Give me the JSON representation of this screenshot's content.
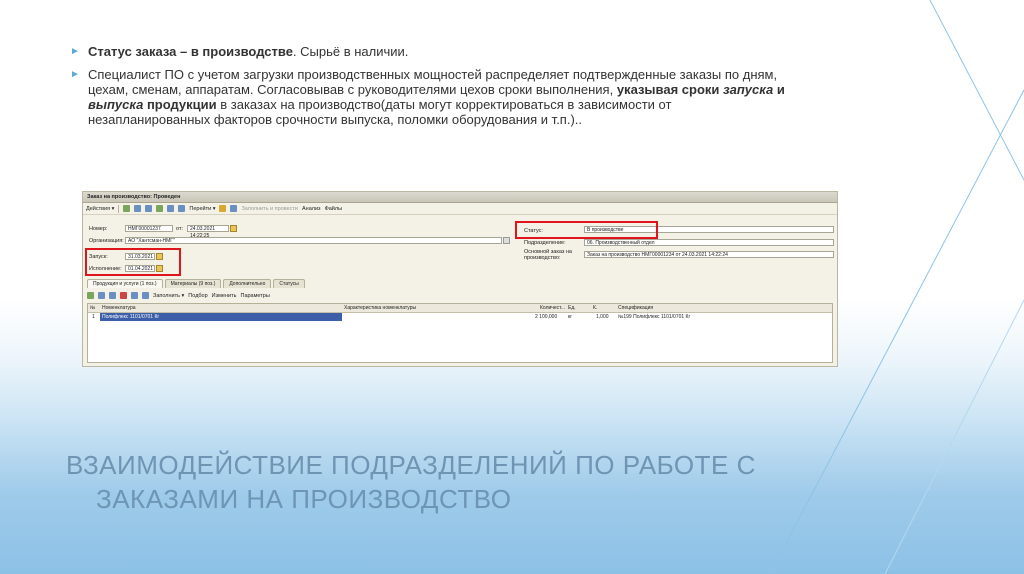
{
  "bullets": [
    {
      "bold": "Статус заказа – в производстве",
      "rest": ". Сырьё в наличии."
    },
    {
      "text_a": "Специалист ПО с учетом загрузки производственных мощностей распределяет подтвержденные заказы по дням, цехам, сменам, аппаратам. Согласовывав с руководителями цехов сроки выполнения,",
      "bold_a": " указывая сроки ",
      "bi_a": "запуска",
      "bold_b": " и ",
      "bi_b": "выпуска",
      "bold_c": " продукции",
      "text_b": " в заказах на производство(даты могут корректироваться в зависимости от незапланированных факторов срочности выпуска, поломки оборудования и т.п.).."
    }
  ],
  "title": {
    "line1": "ВЗАИМОДЕЙСТВИЕ ПОДРАЗДЕЛЕНИЙ ПО РАБОТЕ С",
    "line2": "ЗАКАЗАМИ НА ПРОИЗВОДСТВО"
  },
  "app": {
    "window_title": "Заказ на производство: Проведен",
    "toolbar": {
      "actions": "Действия ▾",
      "goto": "Перейти ▾",
      "fill_post": "Заполнить и провести",
      "analysis": "Анализ",
      "files": "Файлы"
    },
    "fields": {
      "number_label": "Номер:",
      "number_value": "НМГ00001237",
      "from_label": "от:",
      "date_value": "24.03.2021 14:22:25",
      "org_label": "Организация:",
      "org_value": "АО \"Хантсман-НМГ\"",
      "launch_label": "Запуск:",
      "launch_value": "31.03.2021",
      "exec_label": "Исполнение:",
      "exec_value": "01.04.2021",
      "status_label": "Статус:",
      "status_value": "В производстве",
      "dept_label": "Подразделение:",
      "dept_value": "06. Производственный отдел",
      "base_label": "Основной заказ на производство:",
      "base_value": "Заказ на производство НМГ00001234 от 24.03.2021 14:22:24"
    },
    "tabs": [
      "Продукция и услуги (1 поз.)",
      "Материалы (9 поз.)",
      "Дополнительно",
      "Статусы"
    ],
    "subtoolbar": {
      "fill": "Заполнить ▾",
      "select": "Подбор",
      "change": "Изменить",
      "params": "Параметры"
    },
    "table": {
      "headers": [
        "№",
        "Номенклатура",
        "Характеристика номенклатуры",
        "Количест...",
        "Ед.",
        "К.",
        "Спецификация"
      ],
      "rows": [
        {
          "n": "1",
          "item": "Полифлекс 1101/0701 Кг",
          "char": "",
          "qty": "2 100,000",
          "unit": "кг",
          "k": "1,000",
          "spec": "№199 Полифлекс 1101/0701 Кг"
        }
      ]
    }
  }
}
